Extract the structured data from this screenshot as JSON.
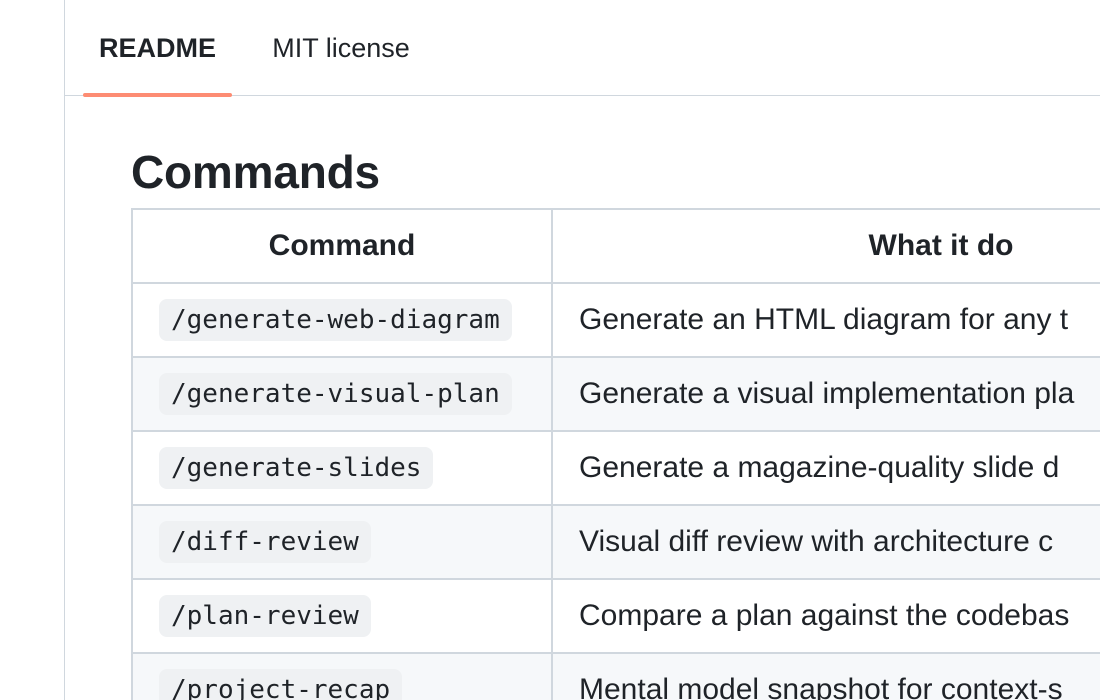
{
  "tabs": {
    "readme": "README",
    "license": "MIT license"
  },
  "section": {
    "title": "Commands"
  },
  "table": {
    "headers": {
      "command": "Command",
      "description": "What it do"
    },
    "rows": [
      {
        "command": "/generate-web-diagram",
        "description": "Generate an HTML diagram for any t"
      },
      {
        "command": "/generate-visual-plan",
        "description": "Generate a visual implementation pla"
      },
      {
        "command": "/generate-slides",
        "description": "Generate a magazine-quality slide d"
      },
      {
        "command": "/diff-review",
        "description": "Visual diff review with architecture c"
      },
      {
        "command": "/plan-review",
        "description": "Compare a plan against the codebas"
      },
      {
        "command": "/project-recap",
        "description": "Mental model snapshot for context-s"
      }
    ]
  },
  "colors": {
    "accent_underline": "#fd8c73",
    "border": "#d0d7de",
    "code_background": "#eff1f3",
    "zebra_row": "#f6f8fa",
    "text": "#1f2328"
  }
}
